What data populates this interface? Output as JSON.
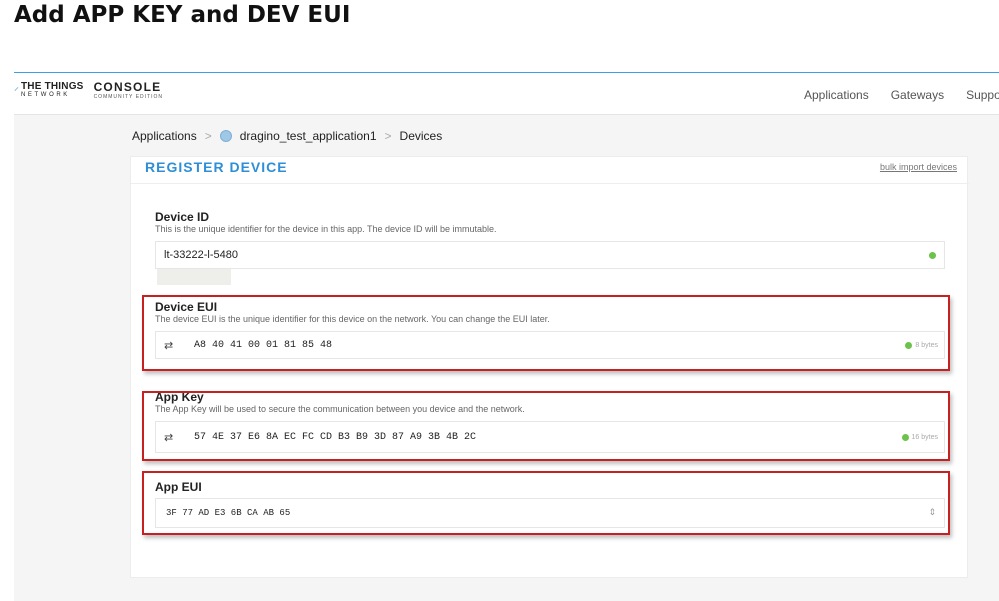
{
  "doc": {
    "heading": "Add APP KEY and DEV EUI"
  },
  "topbar": {
    "brand_ttn_line1": "THE THINGS",
    "brand_ttn_line2": "NETWORK",
    "brand_console_line1": "CONSOLE",
    "brand_console_line2": "COMMUNITY EDITION",
    "nav": [
      "Applications",
      "Gateways",
      "Suppor"
    ]
  },
  "breadcrumb": {
    "items": [
      "Applications",
      "dragino_test_application1",
      "Devices"
    ],
    "separator": ">"
  },
  "register": {
    "title": "REGISTER DEVICE",
    "bulk_import": "bulk import devices",
    "device_id": {
      "label": "Device ID",
      "description": "This is the unique identifier for the device in this app. The device ID will be immutable.",
      "value": "lt-33222-l-5480"
    },
    "device_eui": {
      "label": "Device EUI",
      "description": "The device EUI is the unique identifier for this device on the network. You can change the EUI later.",
      "value": "A8 40 41 00 01 81 85 48",
      "size": "8 bytes"
    },
    "app_key": {
      "label": "App Key",
      "description": "The App Key will be used to secure the communication between you device and the network.",
      "value": "57 4E 37 E6 8A EC FC CD B3 B9 3D 87 A9 3B 4B 2C",
      "size": "16 bytes"
    },
    "app_eui": {
      "label": "App EUI",
      "value": "3F 77 AD E3 6B CA AB 65"
    }
  },
  "colors": {
    "accent": "#2e8fd6",
    "highlight": "#c62020",
    "valid": "#6cc24a"
  },
  "icons": {
    "shuffle": "shuffle-icon",
    "valid": "green-dot-icon",
    "stepper": "up-down-chevron-icon",
    "application": "application-icon"
  }
}
